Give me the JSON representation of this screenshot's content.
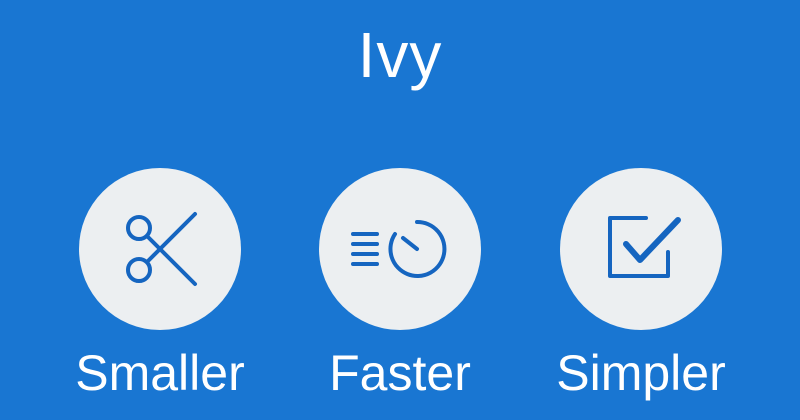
{
  "title": "Ivy",
  "colors": {
    "background": "#1976D2",
    "circle": "#ECEFF1",
    "icon": "#1565C0",
    "text": "#FFFFFF"
  },
  "features": [
    {
      "label": "Smaller",
      "icon": "scissors-icon"
    },
    {
      "label": "Faster",
      "icon": "speed-timer-icon"
    },
    {
      "label": "Simpler",
      "icon": "checkbox-checked-icon"
    }
  ]
}
